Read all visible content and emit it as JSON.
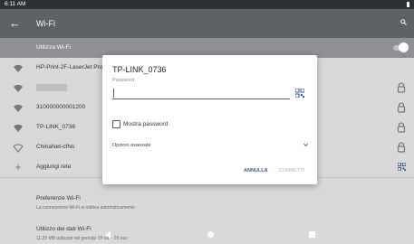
{
  "status_bar": {
    "time": "6:11 AM"
  },
  "app_bar": {
    "title": "Wi-Fi",
    "back_icon": "arrow-left-icon",
    "search_icon": "search-icon"
  },
  "wifi_toggle": {
    "label": "Utilizza Wi-Fi",
    "on": true
  },
  "networks": [
    {
      "name": "HP-Print-2F-LaserJet Pro",
      "icon": "wifi-icon",
      "locked": false
    },
    {
      "name": "",
      "icon": "wifi-icon",
      "locked": true
    },
    {
      "name": "310000000001200",
      "icon": "wifi-icon",
      "locked": true
    },
    {
      "name": "TP-LINK_0736",
      "icon": "wifi-icon",
      "locked": true
    },
    {
      "name": "ChinaNet-cfNs",
      "icon": "wifi-outline-icon",
      "locked": true
    }
  ],
  "add_network": {
    "label": "Aggiungi rete",
    "icon": "plus-icon",
    "action_icon": "qr-code-icon"
  },
  "preferences": {
    "title": "Preferenze Wi-Fi",
    "subtitle": "La connessione Wi-Fi si riattiva automaticamente"
  },
  "data_usage": {
    "title": "Utilizzo dei dati Wi-Fi",
    "subtitle": "11,25 MB utilizzati nel periodo 29 ott – 26 nov"
  },
  "dialog": {
    "title": "TP-LINK_0736",
    "password_label": "Password",
    "password_value": "",
    "show_password_label": "Mostra password",
    "show_password_checked": false,
    "advanced_label": "Opzioni avanzate",
    "cancel_label": "ANNULLA",
    "connect_label": "CONNETTI",
    "colors": {
      "accent": "#3b5a9a",
      "disabled": "#c4c7cc"
    }
  },
  "nav_bar": {
    "back": "nav-back-icon",
    "home": "nav-home-icon",
    "recents": "nav-recents-icon"
  }
}
